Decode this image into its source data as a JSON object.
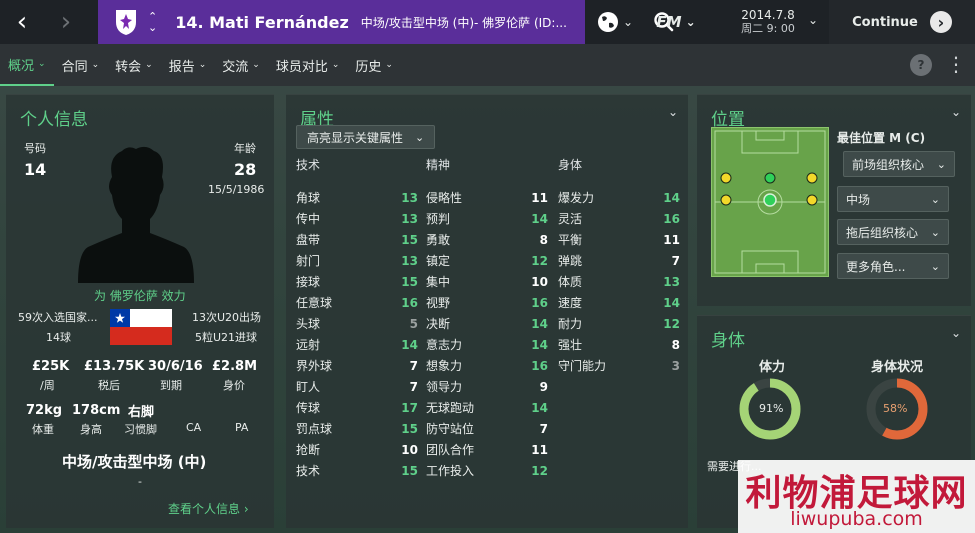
{
  "topbar": {
    "back_icon": "chevron-left-icon",
    "forward_icon": "chevron-right-icon",
    "player_title": "14. Mati Fernández",
    "player_subtitle": "中场/攻击型中场 (中)- 佛罗伦萨 (ID:...",
    "date": "2014.7.8",
    "time": "周二 9: 00",
    "fm_label": "FM",
    "continue_label": "Continue"
  },
  "subnav": {
    "items": [
      "概况",
      "合同",
      "转会",
      "报告",
      "交流",
      "球员对比",
      "历史"
    ],
    "active": "概况",
    "help": "?"
  },
  "personal": {
    "title": "个人信息",
    "number_label": "号码",
    "number": "14",
    "age_label": "年龄",
    "age": "28",
    "dob": "15/5/1986",
    "plays_for": "为 佛罗伦萨 效力",
    "intl_caps": "59次入选国家...",
    "intl_goals": "14球",
    "u20": "13次U20出场",
    "u21": "5粒U21进球",
    "wage": "£25K",
    "wage_label": "/周",
    "net": "£13.75K",
    "net_label": "税后",
    "expiry": "30/6/16",
    "expiry_label": "到期",
    "value": "£2.8M",
    "value_label": "身价",
    "weight": "72kg",
    "weight_label": "体重",
    "height": "178cm",
    "height_label": "身高",
    "foot": "右脚",
    "foot_label": "习惯脚",
    "ca_label": "CA",
    "pa_label": "PA",
    "position": "中场/攻击型中场 (中)",
    "dash": "-",
    "view_link": "查看个人信息 ›"
  },
  "attributes": {
    "title": "属性",
    "highlight_label": "高亮显示关键属性",
    "col1_title": "技术",
    "col2_title": "精神",
    "col3_title": "身体",
    "technical": [
      {
        "n": "角球",
        "v": "13",
        "c": "g"
      },
      {
        "n": "传中",
        "v": "13",
        "c": "g"
      },
      {
        "n": "盘带",
        "v": "15",
        "c": "g"
      },
      {
        "n": "射门",
        "v": "13",
        "c": "g"
      },
      {
        "n": "接球",
        "v": "15",
        "c": "g"
      },
      {
        "n": "任意球",
        "v": "16",
        "c": "g"
      },
      {
        "n": "头球",
        "v": "5",
        "c": "gr"
      },
      {
        "n": "远射",
        "v": "14",
        "c": "g"
      },
      {
        "n": "界外球",
        "v": "7",
        "c": "w"
      },
      {
        "n": "盯人",
        "v": "7",
        "c": "w"
      },
      {
        "n": "传球",
        "v": "17",
        "c": "g"
      },
      {
        "n": "罚点球",
        "v": "15",
        "c": "g"
      },
      {
        "n": "抢断",
        "v": "10",
        "c": "w"
      },
      {
        "n": "技术",
        "v": "15",
        "c": "g"
      }
    ],
    "mental": [
      {
        "n": "侵略性",
        "v": "11",
        "c": "w"
      },
      {
        "n": "预判",
        "v": "14",
        "c": "g"
      },
      {
        "n": "勇敢",
        "v": "8",
        "c": "w"
      },
      {
        "n": "镇定",
        "v": "12",
        "c": "g"
      },
      {
        "n": "集中",
        "v": "10",
        "c": "w"
      },
      {
        "n": "视野",
        "v": "16",
        "c": "g"
      },
      {
        "n": "决断",
        "v": "14",
        "c": "g"
      },
      {
        "n": "意志力",
        "v": "14",
        "c": "g"
      },
      {
        "n": "想象力",
        "v": "16",
        "c": "g"
      },
      {
        "n": "领导力",
        "v": "9",
        "c": "w"
      },
      {
        "n": "无球跑动",
        "v": "14",
        "c": "g"
      },
      {
        "n": "防守站位",
        "v": "7",
        "c": "w"
      },
      {
        "n": "团队合作",
        "v": "11",
        "c": "w"
      },
      {
        "n": "工作投入",
        "v": "12",
        "c": "g"
      }
    ],
    "physical": [
      {
        "n": "爆发力",
        "v": "14",
        "c": "g"
      },
      {
        "n": "灵活",
        "v": "16",
        "c": "g"
      },
      {
        "n": "平衡",
        "v": "11",
        "c": "w"
      },
      {
        "n": "弹跳",
        "v": "7",
        "c": "w"
      },
      {
        "n": "体质",
        "v": "13",
        "c": "g"
      },
      {
        "n": "速度",
        "v": "14",
        "c": "g"
      },
      {
        "n": "耐力",
        "v": "12",
        "c": "g"
      },
      {
        "n": "强壮",
        "v": "8",
        "c": "w"
      },
      {
        "n": "守门能力",
        "v": "3",
        "c": "gr"
      }
    ]
  },
  "position_panel": {
    "title": "位置",
    "best_label": "最佳位置 M (C)",
    "roles": [
      "前场组织核心",
      "中场",
      "拖后组织核心",
      "更多角色..."
    ]
  },
  "physical_panel": {
    "title": "身体",
    "fitness_label": "体力",
    "fitness_value": "91%",
    "fitness_fraction": 0.91,
    "condition_label": "身体状况",
    "condition_value": "58%",
    "condition_fraction": 0.58,
    "note": "需要进行..."
  },
  "watermark": {
    "line1": "利物浦足球网",
    "line2": "liwupuba.com"
  },
  "colors": {
    "accent_green": "#5fd08a",
    "club_purple": "#5a2e9a",
    "fitness_ring": "#a5d476",
    "condition_ring": "#e0683a"
  }
}
